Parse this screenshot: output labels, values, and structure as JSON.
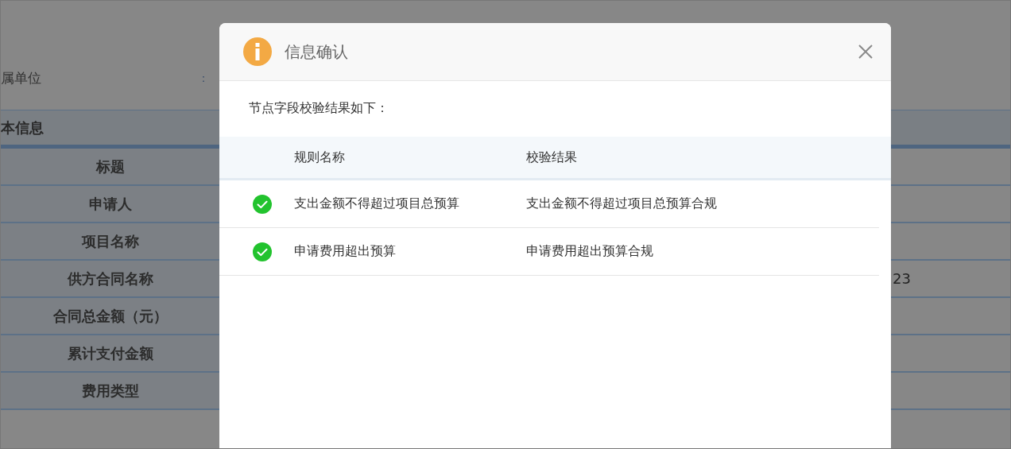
{
  "page": {
    "unit_label": "属单位",
    "unit_separator": "：",
    "section_title": "本信息",
    "fields": [
      {
        "label": "标题"
      },
      {
        "label": "申请人"
      },
      {
        "label": "项目名称"
      },
      {
        "label": "供方合同名称",
        "value": "23"
      },
      {
        "label": "合同总金额（元）"
      },
      {
        "label": "累计支付金额"
      },
      {
        "label": "费用类型"
      }
    ]
  },
  "dialog": {
    "title": "信息确认",
    "message": "节点字段校验结果如下：",
    "columns": [
      "规则名称",
      "校验结果"
    ],
    "rows": [
      {
        "kind": "check",
        "rule": "支出金额不得超过项目总预算",
        "result": "支出金额不得超过项目总预算合规"
      },
      {
        "kind": "check",
        "rule": "申请费用超出预算",
        "result": "申请费用超出预算合规"
      }
    ]
  }
}
